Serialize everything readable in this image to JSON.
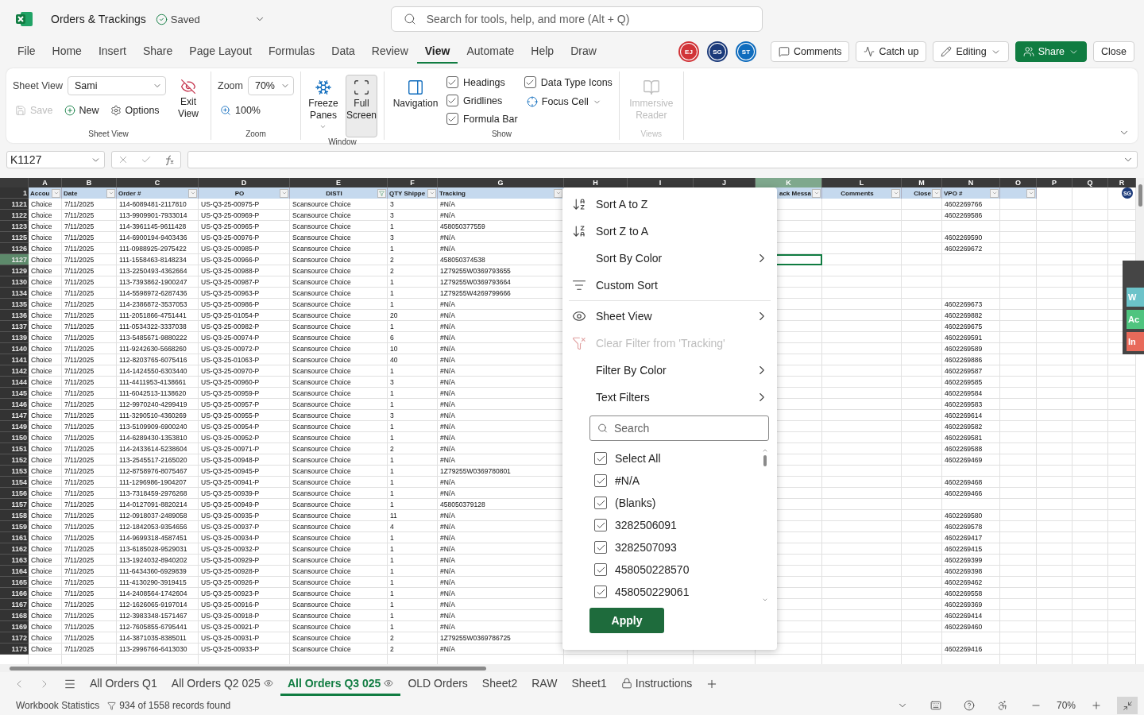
{
  "title_bar": {
    "app_title": "Orders & Trackings",
    "save_status": "Saved",
    "search": {
      "placeholder": "Search for tools, help, and more (Alt + Q)"
    }
  },
  "menu": [
    {
      "label": "File",
      "selected": false
    },
    {
      "label": "Home",
      "selected": false
    },
    {
      "label": "Insert",
      "selected": false
    },
    {
      "label": "Share",
      "selected": false
    },
    {
      "label": "Page Layout",
      "selected": false
    },
    {
      "label": "Formulas",
      "selected": false
    },
    {
      "label": "Data",
      "selected": false
    },
    {
      "label": "Review",
      "selected": false
    },
    {
      "label": "View",
      "selected": true
    },
    {
      "label": "Automate",
      "selected": false
    },
    {
      "label": "Help",
      "selected": false
    },
    {
      "label": "Draw",
      "selected": false
    }
  ],
  "collaborators": [
    {
      "initials": "EJ",
      "color": "#d13438"
    },
    {
      "initials": "SG",
      "color": "#1b3a7a"
    },
    {
      "initials": "ST",
      "color": "#0f6cbd"
    }
  ],
  "actions": [
    {
      "label": "Comments",
      "kind": "comments"
    },
    {
      "label": "Catch up",
      "kind": "catchup"
    },
    {
      "label": "Editing",
      "kind": "editing"
    },
    {
      "label": "Share",
      "kind": "share"
    },
    {
      "label": "Close",
      "kind": "plain"
    }
  ],
  "ribbon": {
    "groups": [
      {
        "kind": "sheet_view",
        "label": "Sheet View",
        "disabled": false,
        "field": {
          "label": "Sheet View",
          "value": "Sami"
        },
        "controls": [
          {
            "kind": "button",
            "label": "Save",
            "disabled": true
          },
          {
            "kind": "button",
            "label": "New",
            "disabled": false
          },
          {
            "kind": "button",
            "label": "Options",
            "disabled": false
          },
          {
            "kind": "large",
            "label": "Exit View",
            "disabled": false
          }
        ]
      },
      {
        "kind": "zoom",
        "label": "Zoom",
        "disabled": false,
        "field": {
          "label": "Zoom",
          "value": "70%"
        },
        "controls": [
          {
            "kind": "button",
            "label": "100%",
            "disabled": false
          }
        ]
      },
      {
        "kind": "window",
        "label": "Window",
        "disabled": false,
        "controls": [
          {
            "kind": "large",
            "label": "Freeze Panes",
            "dropdown": true,
            "selected": false,
            "disabled": false
          },
          {
            "kind": "large",
            "label": "Full Screen",
            "dropdown": false,
            "selected": true,
            "disabled": false
          }
        ]
      },
      {
        "kind": "show",
        "label": "Show",
        "disabled": false,
        "controls": [
          {
            "kind": "large",
            "label": "Navigation",
            "disabled": false
          },
          {
            "kind": "checkbox",
            "label": "Headings",
            "checked": true
          },
          {
            "kind": "checkbox",
            "label": "Gridlines",
            "checked": true
          },
          {
            "kind": "checkbox",
            "label": "Formula Bar",
            "checked": true
          },
          {
            "kind": "checkbox",
            "label": "Data Type Icons",
            "checked": true
          },
          {
            "kind": "button",
            "label": "Focus Cell",
            "dropdown": true,
            "disabled": false
          }
        ]
      },
      {
        "kind": "views",
        "label": "Views",
        "disabled": true,
        "controls": [
          {
            "kind": "large",
            "label": "Immersive Reader",
            "disabled": true
          }
        ]
      }
    ]
  },
  "formula_bar": {
    "name_box": "K1127"
  },
  "sheet": {
    "columns": [
      {
        "letter": "A",
        "header": "Accou",
        "filter_button": true,
        "filtered": false,
        "centered": false,
        "right_aligned": false,
        "selected": false
      },
      {
        "letter": "B",
        "header": "Date",
        "filter_button": true,
        "filtered": false,
        "centered": false,
        "right_aligned": false,
        "selected": false
      },
      {
        "letter": "C",
        "header": "Order #",
        "filter_button": true,
        "filtered": false,
        "centered": false,
        "right_aligned": false,
        "selected": false
      },
      {
        "letter": "D",
        "header": "PO",
        "filter_button": true,
        "filtered": false,
        "centered": true,
        "right_aligned": false,
        "selected": false
      },
      {
        "letter": "E",
        "header": "DISTI",
        "filter_button": true,
        "filtered": true,
        "centered": true,
        "right_aligned": false,
        "selected": false
      },
      {
        "letter": "F",
        "header": "QTY Shippe",
        "filter_button": true,
        "filtered": false,
        "centered": false,
        "right_aligned": false,
        "selected": false
      },
      {
        "letter": "G",
        "header": "Tracking",
        "filter_button": true,
        "filtered": false,
        "centered": false,
        "right_aligned": false,
        "selected": false
      },
      {
        "letter": "H",
        "filter_button": false,
        "selected": false
      },
      {
        "letter": "I",
        "filter_button": false,
        "selected": false
      },
      {
        "letter": "J",
        "filter_button": false,
        "selected": false
      },
      {
        "letter": "K",
        "header": "ack Messa",
        "filter_button": true,
        "filtered": false,
        "centered": false,
        "right_aligned": true,
        "selected": true
      },
      {
        "letter": "L",
        "header": "Comments",
        "filter_button": true,
        "filtered": false,
        "centered": true,
        "right_aligned": false,
        "selected": false
      },
      {
        "letter": "M",
        "header": "Close",
        "filter_button": true,
        "filtered": false,
        "centered": false,
        "right_aligned": true,
        "selected": false
      },
      {
        "letter": "N",
        "header": "VPO #",
        "filter_button": true,
        "filtered": false,
        "centered": false,
        "right_aligned": false,
        "selected": false
      },
      {
        "letter": "O",
        "filter_button": true,
        "filtered": false,
        "selected": false
      },
      {
        "letter": "P",
        "filter_button": false,
        "selected": false
      },
      {
        "letter": "Q",
        "filter_button": false,
        "selected": false
      },
      {
        "letter": "R",
        "filter_button": false,
        "selected": false
      }
    ],
    "header_row": "1",
    "presence": {
      "initials": "SG"
    },
    "rows": [
      {
        "num": "1121",
        "selected": false,
        "cells": {
          "A": "Choice",
          "B": "7/11/2025",
          "C": "114-6089481-2117810",
          "D": "US-Q3-25-00975-P",
          "E": "Scansource Choice",
          "F": "3",
          "G": "#N/A",
          "N": "4602269766"
        }
      },
      {
        "num": "1122",
        "selected": false,
        "cells": {
          "A": "Choice",
          "B": "7/11/2025",
          "C": "113-9909901-7933014",
          "D": "US-Q3-25-00969-P",
          "E": "Scansource Choice",
          "F": "3",
          "G": "#N/A",
          "N": "4602269586"
        }
      },
      {
        "num": "1123",
        "selected": false,
        "cells": {
          "A": "Choice",
          "B": "7/11/2025",
          "C": "114-3961145-9611428",
          "D": "US-Q3-25-00965-P",
          "E": "Scansource Choice",
          "F": "1",
          "G": "458050377559"
        }
      },
      {
        "num": "1125",
        "selected": false,
        "cells": {
          "A": "Choice",
          "B": "7/11/2025",
          "C": "114-6900194-9403436",
          "D": "US-Q3-25-00976-P",
          "E": "Scansource Choice",
          "F": "3",
          "G": "#N/A",
          "N": "4602269590"
        }
      },
      {
        "num": "1126",
        "selected": false,
        "cells": {
          "A": "Choice",
          "B": "7/11/2025",
          "C": "111-0988925-2975422",
          "D": "US-Q3-25-00985-P",
          "E": "Scansource Choice",
          "F": "1",
          "G": "#N/A",
          "N": "4602269672"
        }
      },
      {
        "num": "1127",
        "selected": true,
        "cells": {
          "A": "Choice",
          "B": "7/11/2025",
          "C": "111-1558463-8148234",
          "D": "US-Q3-25-00966-P",
          "E": "Scansource Choice",
          "F": "2",
          "G": "458050374538"
        }
      },
      {
        "num": "1129",
        "selected": false,
        "cells": {
          "A": "Choice",
          "B": "7/11/2025",
          "C": "113-2250493-4362664",
          "D": "US-Q3-25-00988-P",
          "E": "Scansource Choice",
          "F": "2",
          "G": "1Z79255W0369793655"
        }
      },
      {
        "num": "1130",
        "selected": false,
        "cells": {
          "A": "Choice",
          "B": "7/11/2025",
          "C": "113-7393862-1900247",
          "D": "US-Q3-25-00987-P",
          "E": "Scansource Choice",
          "F": "1",
          "G": "1Z79255W0369793664"
        }
      },
      {
        "num": "1134",
        "selected": false,
        "cells": {
          "A": "Choice",
          "B": "7/11/2025",
          "C": "114-5598972-6287436",
          "D": "US-Q3-25-00963-P",
          "E": "Scansource Choice",
          "F": "1",
          "G": "1Z79255W4269799666"
        }
      },
      {
        "num": "1135",
        "selected": false,
        "cells": {
          "A": "Choice",
          "B": "7/11/2025",
          "C": "114-2386872-3537053",
          "D": "US-Q3-25-00986-P",
          "E": "Scansource Choice",
          "F": "1",
          "G": "#N/A",
          "N": "4602269673"
        }
      },
      {
        "num": "1136",
        "selected": false,
        "cells": {
          "A": "Choice",
          "B": "7/11/2025",
          "C": "111-2051866-4751441",
          "D": "US-Q3-25-01054-P",
          "E": "Scansource Choice",
          "F": "20",
          "G": "#N/A",
          "N": "4602269882"
        }
      },
      {
        "num": "1137",
        "selected": false,
        "cells": {
          "A": "Choice",
          "B": "7/11/2025",
          "C": "111-0534322-3337038",
          "D": "US-Q3-25-00982-P",
          "E": "Scansource Choice",
          "F": "1",
          "G": "#N/A",
          "N": "4602269675"
        }
      },
      {
        "num": "1139",
        "selected": false,
        "cells": {
          "A": "Choice",
          "B": "7/11/2025",
          "C": "113-5485671-9880222",
          "D": "US-Q3-25-00974-P",
          "E": "Scansource Choice",
          "F": "6",
          "G": "#N/A",
          "N": "4602269591"
        }
      },
      {
        "num": "1140",
        "selected": false,
        "cells": {
          "A": "Choice",
          "B": "7/11/2025",
          "C": "111-9242630-5668260",
          "D": "US-Q3-25-00972-P",
          "E": "Scansource Choice",
          "F": "10",
          "G": "#N/A",
          "N": "4602269589"
        }
      },
      {
        "num": "1141",
        "selected": false,
        "cells": {
          "A": "Choice",
          "B": "7/11/2025",
          "C": "112-8203765-6075416",
          "D": "US-Q3-25-01063-P",
          "E": "Scansource Choice",
          "F": "40",
          "G": "#N/A",
          "N": "4602269886"
        }
      },
      {
        "num": "1142",
        "selected": false,
        "cells": {
          "A": "Choice",
          "B": "7/11/2025",
          "C": "114-1424550-6303440",
          "D": "US-Q3-25-00970-P",
          "E": "Scansource Choice",
          "F": "1",
          "G": "#N/A",
          "N": "4602269587"
        }
      },
      {
        "num": "1144",
        "selected": false,
        "cells": {
          "A": "Choice",
          "B": "7/11/2025",
          "C": "111-4411953-4138661",
          "D": "US-Q3-25-00960-P",
          "E": "Scansource Choice",
          "F": "3",
          "G": "#N/A",
          "N": "4602269585"
        }
      },
      {
        "num": "1145",
        "selected": false,
        "cells": {
          "A": "Choice",
          "B": "7/11/2025",
          "C": "111-6042513-1138620",
          "D": "US-Q3-25-00959-P",
          "E": "Scansource Choice",
          "F": "1",
          "G": "#N/A",
          "N": "4602269584"
        }
      },
      {
        "num": "1146",
        "selected": false,
        "cells": {
          "A": "Choice",
          "B": "7/11/2025",
          "C": "112-9970240-4299419",
          "D": "US-Q3-25-00957-P",
          "E": "Scansource Choice",
          "F": "1",
          "G": "#N/A",
          "N": "4602269583"
        }
      },
      {
        "num": "1147",
        "selected": false,
        "cells": {
          "A": "Choice",
          "B": "7/11/2025",
          "C": "111-3290510-4360269",
          "D": "US-Q3-25-00955-P",
          "E": "Scansource Choice",
          "F": "3",
          "G": "#N/A",
          "N": "4602269614"
        }
      },
      {
        "num": "1149",
        "selected": false,
        "cells": {
          "A": "Choice",
          "B": "7/11/2025",
          "C": "113-5109909-6900240",
          "D": "US-Q3-25-00954-P",
          "E": "Scansource Choice",
          "F": "1",
          "G": "#N/A",
          "N": "4602269582"
        }
      },
      {
        "num": "1150",
        "selected": false,
        "cells": {
          "A": "Choice",
          "B": "7/11/2025",
          "C": "114-6289430-1353810",
          "D": "US-Q3-25-00952-P",
          "E": "Scansource Choice",
          "F": "1",
          "G": "#N/A",
          "N": "4602269581"
        }
      },
      {
        "num": "1151",
        "selected": false,
        "cells": {
          "A": "Choice",
          "B": "7/11/2025",
          "C": "114-2433614-5238604",
          "D": "US-Q3-25-00971-P",
          "E": "Scansource Choice",
          "F": "2",
          "G": "#N/A",
          "N": "4602269588"
        }
      },
      {
        "num": "1152",
        "selected": false,
        "cells": {
          "A": "Choice",
          "B": "7/11/2025",
          "C": "113-2545517-2165020",
          "D": "US-Q3-25-00948-P",
          "E": "Scansource Choice",
          "F": "1",
          "G": "#N/A",
          "N": "4602269469"
        }
      },
      {
        "num": "1153",
        "selected": false,
        "cells": {
          "A": "Choice",
          "B": "7/11/2025",
          "C": "112-8758976-8075467",
          "D": "US-Q3-25-00945-P",
          "E": "Scansource Choice",
          "F": "1",
          "G": "1Z79255W0369780801"
        }
      },
      {
        "num": "1154",
        "selected": false,
        "cells": {
          "A": "Choice",
          "B": "7/11/2025",
          "C": "111-1296986-1904207",
          "D": "US-Q3-25-00941-P",
          "E": "Scansource Choice",
          "F": "1",
          "G": "#N/A",
          "N": "4602269468"
        }
      },
      {
        "num": "1156",
        "selected": false,
        "cells": {
          "A": "Choice",
          "B": "7/11/2025",
          "C": "113-7318459-2976268",
          "D": "US-Q3-25-00939-P",
          "E": "Scansource Choice",
          "F": "1",
          "G": "#N/A",
          "N": "4602269466"
        }
      },
      {
        "num": "1157",
        "selected": false,
        "cells": {
          "A": "Choice",
          "B": "7/11/2025",
          "C": "114-0127091-8820214",
          "D": "US-Q3-25-00949-P",
          "E": "Scansource Choice",
          "F": "1",
          "G": "458050379128"
        }
      },
      {
        "num": "1158",
        "selected": false,
        "cells": {
          "A": "Choice",
          "B": "7/11/2025",
          "C": "112-0918037-2489058",
          "D": "US-Q3-25-00935-P",
          "E": "Scansource Choice",
          "F": "11",
          "G": "#N/A",
          "N": "4602269580"
        }
      },
      {
        "num": "1159",
        "selected": false,
        "cells": {
          "A": "Choice",
          "B": "7/11/2025",
          "C": "112-1842053-9354656",
          "D": "US-Q3-25-00937-P",
          "E": "Scansource Choice",
          "F": "4",
          "G": "#N/A",
          "N": "4602269578"
        }
      },
      {
        "num": "1161",
        "selected": false,
        "cells": {
          "A": "Choice",
          "B": "7/11/2025",
          "C": "114-9699318-4587451",
          "D": "US-Q3-25-00934-P",
          "E": "Scansource Choice",
          "F": "1",
          "G": "#N/A",
          "N": "4602269417"
        }
      },
      {
        "num": "1162",
        "selected": false,
        "cells": {
          "A": "Choice",
          "B": "7/11/2025",
          "C": "113-6185028-9529031",
          "D": "US-Q3-25-00932-P",
          "E": "Scansource Choice",
          "F": "1",
          "G": "#N/A",
          "N": "4602269415"
        }
      },
      {
        "num": "1163",
        "selected": false,
        "cells": {
          "A": "Choice",
          "B": "7/11/2025",
          "C": "113-1924032-8940202",
          "D": "US-Q3-25-00929-P",
          "E": "Scansource Choice",
          "F": "1",
          "G": "#N/A",
          "N": "4602269399"
        }
      },
      {
        "num": "1164",
        "selected": false,
        "cells": {
          "A": "Choice",
          "B": "7/11/2025",
          "C": "111-6434360-6929839",
          "D": "US-Q3-25-00928-P",
          "E": "Scansource Choice",
          "F": "1",
          "G": "#N/A",
          "N": "4602269398"
        }
      },
      {
        "num": "1165",
        "selected": false,
        "cells": {
          "A": "Choice",
          "B": "7/11/2025",
          "C": "111-4130290-3919415",
          "D": "US-Q3-25-00926-P",
          "E": "Scansource Choice",
          "F": "1",
          "G": "#N/A",
          "N": "4602269462"
        }
      },
      {
        "num": "1166",
        "selected": false,
        "cells": {
          "A": "Choice",
          "B": "7/11/2025",
          "C": "114-2408564-1742604",
          "D": "US-Q3-25-00923-P",
          "E": "Scansource Choice",
          "F": "1",
          "G": "#N/A",
          "N": "4602269558"
        }
      },
      {
        "num": "1167",
        "selected": false,
        "cells": {
          "A": "Choice",
          "B": "7/11/2025",
          "C": "112-1626065-9197014",
          "D": "US-Q3-25-00916-P",
          "E": "Scansource Choice",
          "F": "1",
          "G": "#N/A",
          "N": "4602269369"
        }
      },
      {
        "num": "1168",
        "selected": false,
        "cells": {
          "A": "Choice",
          "B": "7/11/2025",
          "C": "112-3983348-1571467",
          "D": "US-Q3-25-00918-P",
          "E": "Scansource Choice",
          "F": "1",
          "G": "#N/A",
          "N": "4602269414"
        }
      },
      {
        "num": "1169",
        "selected": false,
        "cells": {
          "A": "Choice",
          "B": "7/11/2025",
          "C": "112-7605855-6795441",
          "D": "US-Q3-25-00921-P",
          "E": "Scansource Choice",
          "F": "1",
          "G": "#N/A",
          "N": "4602269460"
        }
      },
      {
        "num": "1172",
        "selected": false,
        "cells": {
          "A": "Choice",
          "B": "7/11/2025",
          "C": "114-3871035-8385011",
          "D": "US-Q3-25-00931-P",
          "E": "Scansource Choice",
          "F": "2",
          "G": "1Z79255W0369786725"
        }
      },
      {
        "num": "1173",
        "selected": false,
        "cells": {
          "A": "Choice",
          "B": "7/11/2025",
          "C": "113-2996766-6413030",
          "D": "US-Q3-25-00933-P",
          "E": "Scansource Choice",
          "F": "2",
          "G": "#N/A",
          "N": "4602269416"
        }
      }
    ]
  },
  "filter_menu": {
    "items": [
      {
        "kind": "sort_az",
        "label": "Sort A to Z",
        "submenu": false,
        "disabled": false
      },
      {
        "kind": "sort_za",
        "label": "Sort Z to A",
        "submenu": false,
        "disabled": false
      },
      {
        "kind": "plain",
        "label": "Sort By Color",
        "submenu": true,
        "disabled": false
      },
      {
        "kind": "custom_sort",
        "label": "Custom Sort",
        "submenu": false,
        "disabled": false
      },
      {
        "kind": "divider"
      },
      {
        "kind": "sheet_view",
        "label": "Sheet View",
        "submenu": true,
        "disabled": false
      },
      {
        "kind": "clear",
        "label": "Clear Filter from 'Tracking'",
        "submenu": false,
        "disabled": true
      },
      {
        "kind": "plain",
        "label": "Filter By Color",
        "submenu": true,
        "disabled": false
      },
      {
        "kind": "plain",
        "label": "Text Filters",
        "submenu": true,
        "disabled": false
      }
    ],
    "search": {
      "placeholder": "Search"
    },
    "values": [
      {
        "label": "Select All",
        "checked": true
      },
      {
        "label": "#N/A",
        "checked": true
      },
      {
        "label": "(Blanks)",
        "checked": true
      },
      {
        "label": "3282506091",
        "checked": true
      },
      {
        "label": "3282507093",
        "checked": true
      },
      {
        "label": "458050228570",
        "checked": true
      },
      {
        "label": "458050229061",
        "checked": true
      }
    ],
    "apply": "Apply"
  },
  "side_panel": [
    {
      "label": "W",
      "color": "#6cc3c9"
    },
    {
      "label": "Ac",
      "color": "#4fc47f"
    },
    {
      "label": "In",
      "color": "#e86a5a"
    }
  ],
  "sheet_tabs": [
    {
      "label": "All Orders Q1",
      "sheet_view": false,
      "locked": false,
      "selected": false
    },
    {
      "label": "All Orders Q2 025",
      "sheet_view": true,
      "locked": false,
      "selected": false
    },
    {
      "label": "All Orders Q3 025",
      "sheet_view": true,
      "locked": false,
      "selected": true
    },
    {
      "label": "OLD Orders",
      "sheet_view": false,
      "locked": false,
      "selected": false
    },
    {
      "label": "Sheet2",
      "sheet_view": false,
      "locked": false,
      "selected": false
    },
    {
      "label": "RAW",
      "sheet_view": false,
      "locked": false,
      "selected": false
    },
    {
      "label": "Sheet1",
      "sheet_view": false,
      "locked": false,
      "selected": false
    },
    {
      "label": "Instructions",
      "sheet_view": false,
      "locked": true,
      "selected": false
    }
  ],
  "status_bar": {
    "stats": "Workbook Statistics",
    "filter_count": "934 of 1558 records found",
    "zoom": "70%"
  }
}
